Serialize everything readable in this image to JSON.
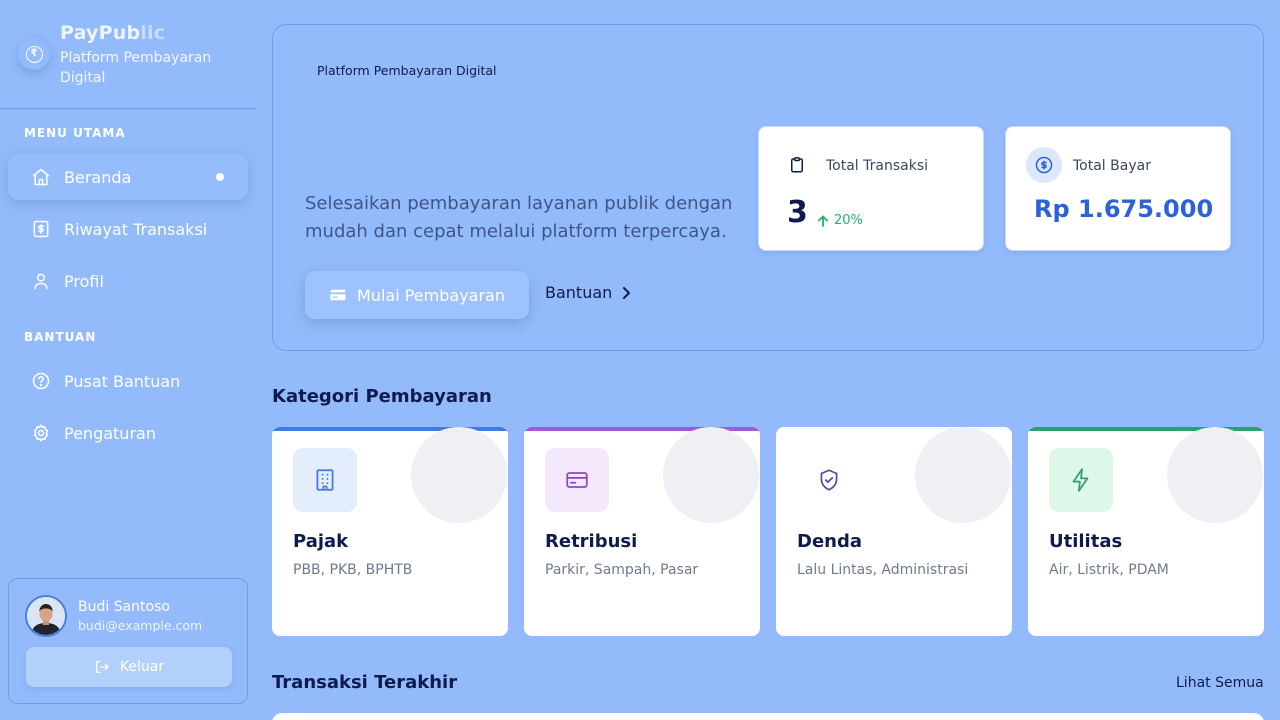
{
  "brand": {
    "name_main": "PayPub",
    "name_fade": "lic",
    "subtitle": "Platform Pembayaran Digital",
    "logo_symbol": "₹",
    "logo_icon": "rupee-circle-icon"
  },
  "sidebar": {
    "main_section_title": "MENU UTAMA",
    "main_items": [
      {
        "label": "Beranda",
        "icon": "home-icon",
        "active": true
      },
      {
        "label": "Riwayat Transaksi",
        "icon": "receipt-icon"
      },
      {
        "label": "Profil",
        "icon": "user-icon"
      }
    ],
    "help_section_title": "BANTUAN",
    "help_items": [
      {
        "label": "Pusat Bantuan",
        "icon": "help-circle-icon"
      },
      {
        "label": "Pengaturan",
        "icon": "gear-icon"
      }
    ]
  },
  "user": {
    "name": "Budi Santoso",
    "email": "budi@example.com",
    "logout_label": "Keluar"
  },
  "hero": {
    "tag": "Platform Pembayaran Digital",
    "description": "Selesaikan pembayaran layanan publik dengan mudah dan cepat melalui platform terpercaya.",
    "start_button": "Mulai Pembayaran",
    "help_link": "Bantuan"
  },
  "stats": {
    "transactions": {
      "label": "Total Transaksi",
      "value": "3",
      "trend": "20%"
    },
    "payment": {
      "label": "Total Bayar",
      "value": "Rp 1.675.000"
    }
  },
  "categories": {
    "heading": "Kategori Pembayaran",
    "items": [
      {
        "title": "Pajak",
        "desc": "PBB, PKB, BPHTB",
        "icon": "building-icon",
        "accent": "#3f7be0"
      },
      {
        "title": "Retribusi",
        "desc": "Parkir, Sampah, Pasar",
        "icon": "card-icon",
        "accent": "#a05ad8"
      },
      {
        "title": "Denda",
        "desc": "Lalu Lintas, Administrasi",
        "icon": "shield-check-icon",
        "accent": "#ffffff"
      },
      {
        "title": "Utilitas",
        "desc": "Air, Listrik, PDAM",
        "icon": "lightning-icon",
        "accent": "#2aa36b"
      }
    ]
  },
  "recent": {
    "heading": "Transaksi Terakhir",
    "see_all": "Lihat Semua"
  },
  "colors": {
    "background": "#93bbfb",
    "primary_text": "#0f1b4d",
    "amount": "#2b62d9",
    "trend_up": "#21b36a"
  }
}
